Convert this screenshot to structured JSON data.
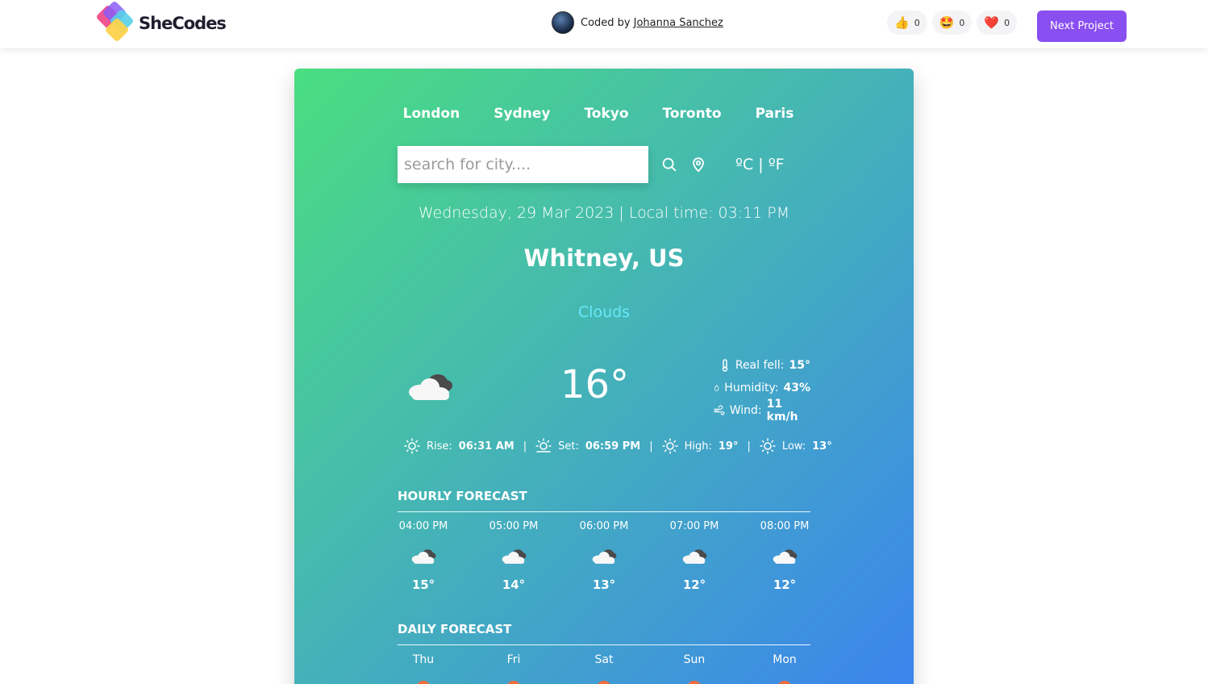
{
  "header": {
    "logo_text": "SheCodes",
    "coded_by_prefix": "Coded by",
    "author": "Johanna Sanchez",
    "reactions": [
      {
        "icon": "thumbs-up-icon",
        "emoji": "👍",
        "count": "0"
      },
      {
        "icon": "star-eyes-icon",
        "emoji": "🤩",
        "count": "0"
      },
      {
        "icon": "heart-icon",
        "emoji": "❤️",
        "count": "0"
      }
    ],
    "next_label": "Next Project",
    "accent": "#8a4ff0"
  },
  "weather": {
    "cities": [
      "London",
      "Sydney",
      "Tokyo",
      "Toronto",
      "Paris"
    ],
    "search_placeholder": "search for city....",
    "units": "ºC | ºF",
    "datetime": "Wednesday, 29 Mar 2023 | Local time: 03:11 PM",
    "location": "Whitney, US",
    "condition": "Clouds",
    "temperature": "16°",
    "real_feel_label": "Real fell:",
    "real_feel": "15°",
    "humidity_label": "Humidity:",
    "humidity": "43%",
    "wind_label": "Wind:",
    "wind": "11 km/h",
    "rise_label": "Rise:",
    "rise": "06:31 AM",
    "set_label": "Set:",
    "set": "06:59 PM",
    "high_label": "High:",
    "high": "19°",
    "low_label": "Low:",
    "low": "13°",
    "hourly_title": "HOURLY FORECAST",
    "hourly": [
      {
        "time": "04:00 PM",
        "temp": "15°"
      },
      {
        "time": "05:00 PM",
        "temp": "14°"
      },
      {
        "time": "06:00 PM",
        "temp": "13°"
      },
      {
        "time": "07:00 PM",
        "temp": "12°"
      },
      {
        "time": "08:00 PM",
        "temp": "12°"
      }
    ],
    "daily_title": "DAILY FORECAST",
    "daily": [
      {
        "day": "Thu"
      },
      {
        "day": "Fri"
      },
      {
        "day": "Sat"
      },
      {
        "day": "Sun"
      },
      {
        "day": "Mon"
      }
    ]
  }
}
